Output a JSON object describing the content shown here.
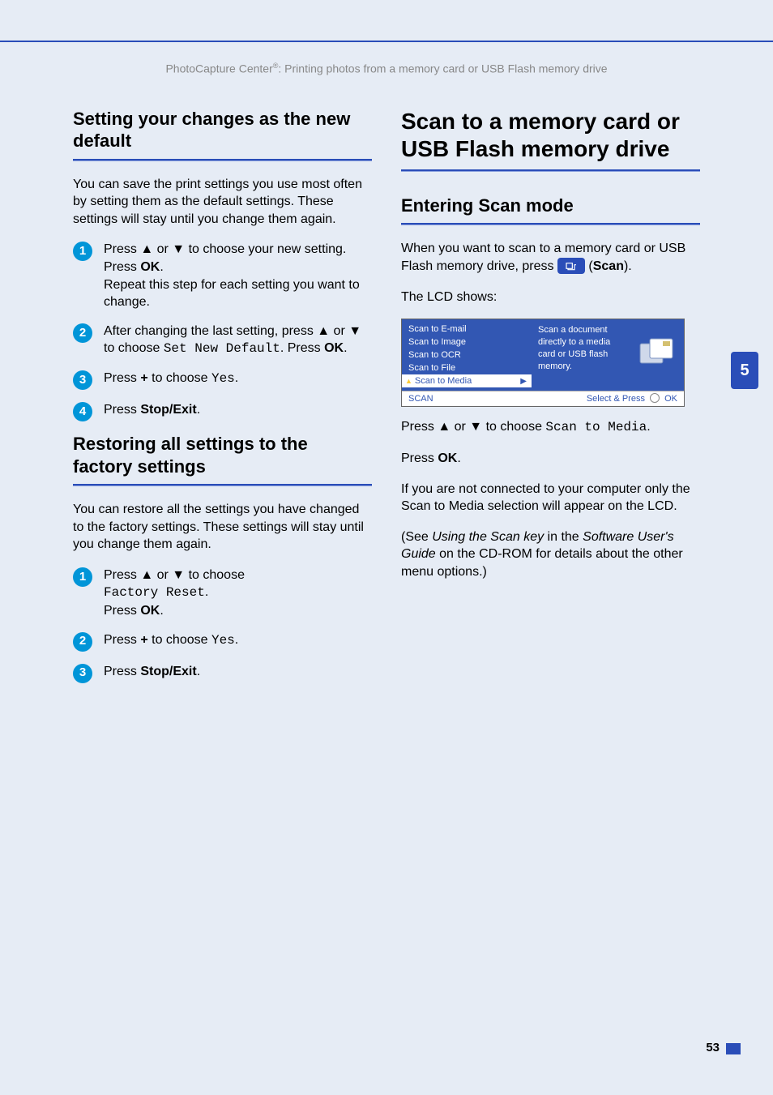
{
  "running_head": {
    "prefix": "PhotoCapture Center",
    "sup": "®",
    "suffix": ": Printing photos from a memory card or USB Flash memory drive"
  },
  "side_tab": "5",
  "page_number": "53",
  "left": {
    "h1": "Setting your changes as the new default",
    "intro": "You can save the print settings you use most often by setting them as the default settings. These settings will stay until you change them again.",
    "steps": [
      {
        "n": "1",
        "lines": [
          "Press ▲ or ▼ to choose your new setting. Press ",
          "OK",
          ".",
          " Repeat this step for each setting you want to change."
        ]
      },
      {
        "n": "2",
        "lines": [
          "After changing the last setting, press ▲ or ▼ to choose ",
          "Set New Default",
          ". Press ",
          "OK",
          "."
        ]
      },
      {
        "n": "3",
        "lines": [
          "Press ",
          "+",
          " to choose ",
          "Yes",
          "."
        ]
      },
      {
        "n": "4",
        "lines": [
          "Press ",
          "Stop/Exit",
          "."
        ]
      }
    ],
    "h2": "Restoring all settings to the factory settings",
    "intro2": "You can restore all the settings you have changed to the factory settings. These settings will stay until you change them again.",
    "steps2": [
      {
        "n": "1",
        "lines": [
          "Press ▲ or ▼ to choose ",
          "Factory Reset",
          ". Press ",
          "OK",
          "."
        ]
      },
      {
        "n": "2",
        "lines": [
          "Press ",
          "+",
          " to choose ",
          "Yes",
          "."
        ]
      },
      {
        "n": "3",
        "lines": [
          "Press ",
          "Stop/Exit",
          "."
        ]
      }
    ]
  },
  "right": {
    "h1": "Scan to a memory card or USB Flash memory drive",
    "h2": "Entering Scan mode",
    "p1_a": "When you want to scan to a memory card or USB Flash memory drive, press ",
    "p1_b": " (",
    "p1_scan": "Scan",
    "p1_c": ").",
    "p2": "The LCD shows:",
    "lcd": {
      "menu": [
        "Scan to E-mail",
        "Scan to Image",
        "Scan to OCR",
        "Scan to File"
      ],
      "menu_sel": "Scan to Media",
      "desc": "Scan a document directly to a media card or USB flash memory.",
      "bl_left": "SCAN",
      "bl_right_a": "Select & Press",
      "bl_right_b": "OK"
    },
    "p3_a": "Press ▲ or ▼ to choose ",
    "p3_mono": "Scan to Media",
    "p3_b": ".",
    "p4": "Press ",
    "p4_ok": "OK",
    "p4_b": ".",
    "p5": "If you are not connected to your computer only the Scan to Media selection will appear on the LCD.",
    "p6_a": "(See ",
    "p6_i1": "Using the Scan key",
    "p6_b": " in the ",
    "p6_i2": "Software User's Guide",
    "p6_c": " on the CD-ROM for details about the other menu options.)"
  }
}
